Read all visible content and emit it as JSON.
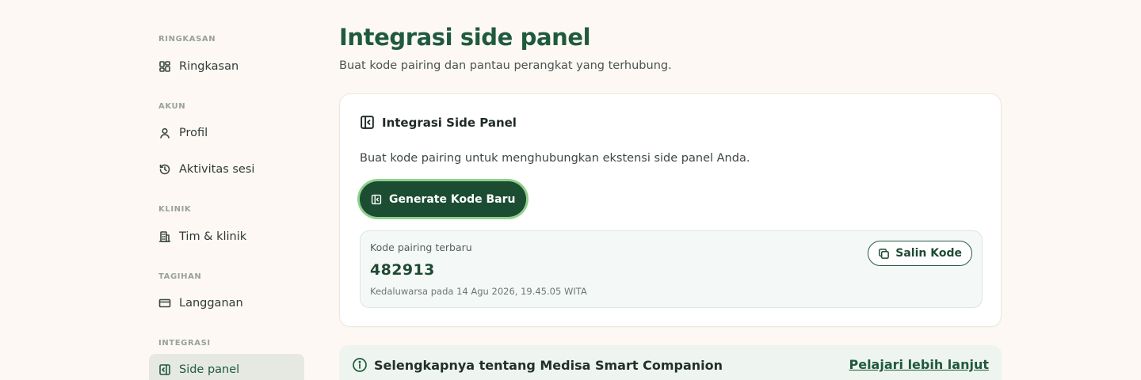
{
  "sidebar": {
    "sections": [
      {
        "label": "RINGKASAN",
        "items": [
          {
            "label": "Ringkasan",
            "icon": "dashboard-icon"
          }
        ]
      },
      {
        "label": "AKUN",
        "items": [
          {
            "label": "Profil",
            "icon": "user-icon"
          },
          {
            "label": "Aktivitas sesi",
            "icon": "history-icon"
          }
        ]
      },
      {
        "label": "KLINIK",
        "items": [
          {
            "label": "Tim & klinik",
            "icon": "building-icon"
          }
        ]
      },
      {
        "label": "TAGIHAN",
        "items": [
          {
            "label": "Langganan",
            "icon": "credit-card-icon"
          }
        ]
      },
      {
        "label": "INTEGRASI",
        "items": [
          {
            "label": "Side panel",
            "icon": "side-panel-icon",
            "active": true
          }
        ]
      }
    ]
  },
  "main": {
    "title": "Integrasi side panel",
    "subtitle": "Buat kode pairing dan pantau perangkat yang terhubung.",
    "card": {
      "title": "Integrasi Side Panel",
      "description": "Buat kode pairing untuk menghubungkan ekstensi side panel Anda.",
      "generate_label": "Generate Kode Baru",
      "code_label": "Kode pairing terbaru",
      "code_value": "482913",
      "expiry": "Kedaluwarsa pada 14 Agu 2026, 19.45.05 WITA",
      "copy_label": "Salin Kode"
    },
    "info": {
      "title": "Selengkapnya tentang Medisa Smart Companion",
      "link": "Pelajari lebih lanjut"
    }
  },
  "colors": {
    "background": "#fdf8f3",
    "accent": "#1f5a3c",
    "button_bg": "#1c4d33",
    "button_glow": "#8fd18d",
    "active_nav_bg": "#e6e9e1"
  }
}
